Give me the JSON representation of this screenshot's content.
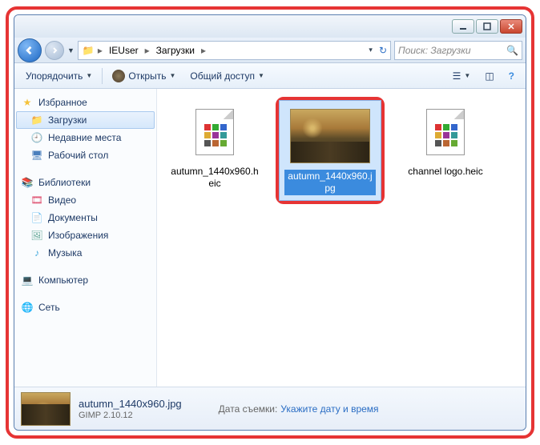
{
  "breadcrumb": {
    "user": "IEUser",
    "folder": "Загрузки"
  },
  "search": {
    "placeholder": "Поиск: Загрузки"
  },
  "toolbar": {
    "organize": "Упорядочить",
    "open": "Открыть",
    "share": "Общий доступ"
  },
  "sidebar": {
    "favorites": {
      "header": "Избранное",
      "downloads": "Загрузки",
      "recent": "Недавние места",
      "desktop": "Рабочий стол"
    },
    "libraries": {
      "header": "Библиотеки",
      "videos": "Видео",
      "documents": "Документы",
      "pictures": "Изображения",
      "music": "Музыка"
    },
    "computer": "Компьютер",
    "network": "Сеть"
  },
  "files": {
    "items": [
      {
        "name": "autumn_1440x960.heic"
      },
      {
        "name": "autumn_1440x960.jpg"
      },
      {
        "name": "channel logo.heic"
      }
    ]
  },
  "details": {
    "filename": "autumn_1440x960.jpg",
    "app": "GIMP 2.10.12",
    "date_label": "Дата съемки:",
    "date_hint": "Укажите дату и время"
  }
}
